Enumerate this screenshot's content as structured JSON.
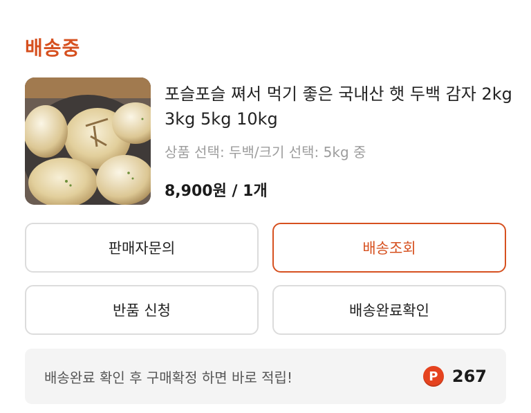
{
  "order": {
    "status": "배송중",
    "accent_color": "#d6501f"
  },
  "product": {
    "image_icon": "potato-photo",
    "title": "포슬포슬 쪄서 먹기 좋은 국내산 햇 두백 감자 2kg 3kg 5kg 10kg",
    "option": "상품 선택: 두백/크기 선택: 5kg 중",
    "price": "8,900원 / 1개"
  },
  "actions": {
    "seller_inquiry": "판매자문의",
    "track_delivery": "배송조회",
    "return_request": "반품 신청",
    "confirm_delivery": "배송완료확인"
  },
  "notice": {
    "text": "배송완료 확인 후 구매확정 하면 바로 적립!",
    "point_icon": "P",
    "points": "267",
    "point_color": "#e5431f"
  }
}
